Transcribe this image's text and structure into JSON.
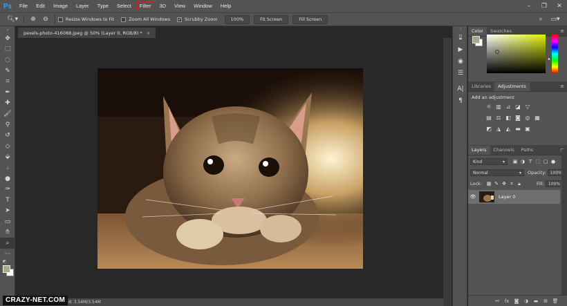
{
  "app": {
    "logo": "Ps"
  },
  "menu": [
    "File",
    "Edit",
    "Image",
    "Layer",
    "Type",
    "Select",
    "Filter",
    "3D",
    "View",
    "Window",
    "Help"
  ],
  "menu_highlighted": "Filter",
  "options": {
    "resize_windows": "Resize Windows to Fit",
    "zoom_all": "Zoom All Windows",
    "scrubby_zoom": "Scrubby Zoom",
    "zoom_value": "100%",
    "fit_screen": "Fit Screen",
    "fill_screen": "Fill Screen"
  },
  "document": {
    "tab_title": "pexels-photo-416088.jpeg @ 50% (Layer 0, RGB/8) *",
    "close": "×",
    "status": "d: 3.54M/3.54M"
  },
  "watermark": "CRAZY-NET.COM",
  "color_panel": {
    "tabs": [
      "Color",
      "Swatches"
    ],
    "active": "Color",
    "fg_color": "#a9a98a"
  },
  "adjustments_panel": {
    "tabs": [
      "Libraries",
      "Adjustments"
    ],
    "active": "Adjustments",
    "title": "Add an adjustment"
  },
  "layers_panel": {
    "tabs": [
      "Layers",
      "Channels",
      "Paths"
    ],
    "active": "Layers",
    "filter_kind": "Kind",
    "blend_mode": "Normal",
    "opacity_label": "Opacity:",
    "opacity_value": "100%",
    "lock_label": "Lock:",
    "fill_label": "Fill:",
    "fill_value": "100%",
    "layers": [
      {
        "name": "Layer 0",
        "visible": true
      }
    ]
  },
  "colors": {
    "chrome": "#535353",
    "dark": "#282828",
    "highlight_ring": "#d62020",
    "ps_blue": "#2fa3f7"
  }
}
